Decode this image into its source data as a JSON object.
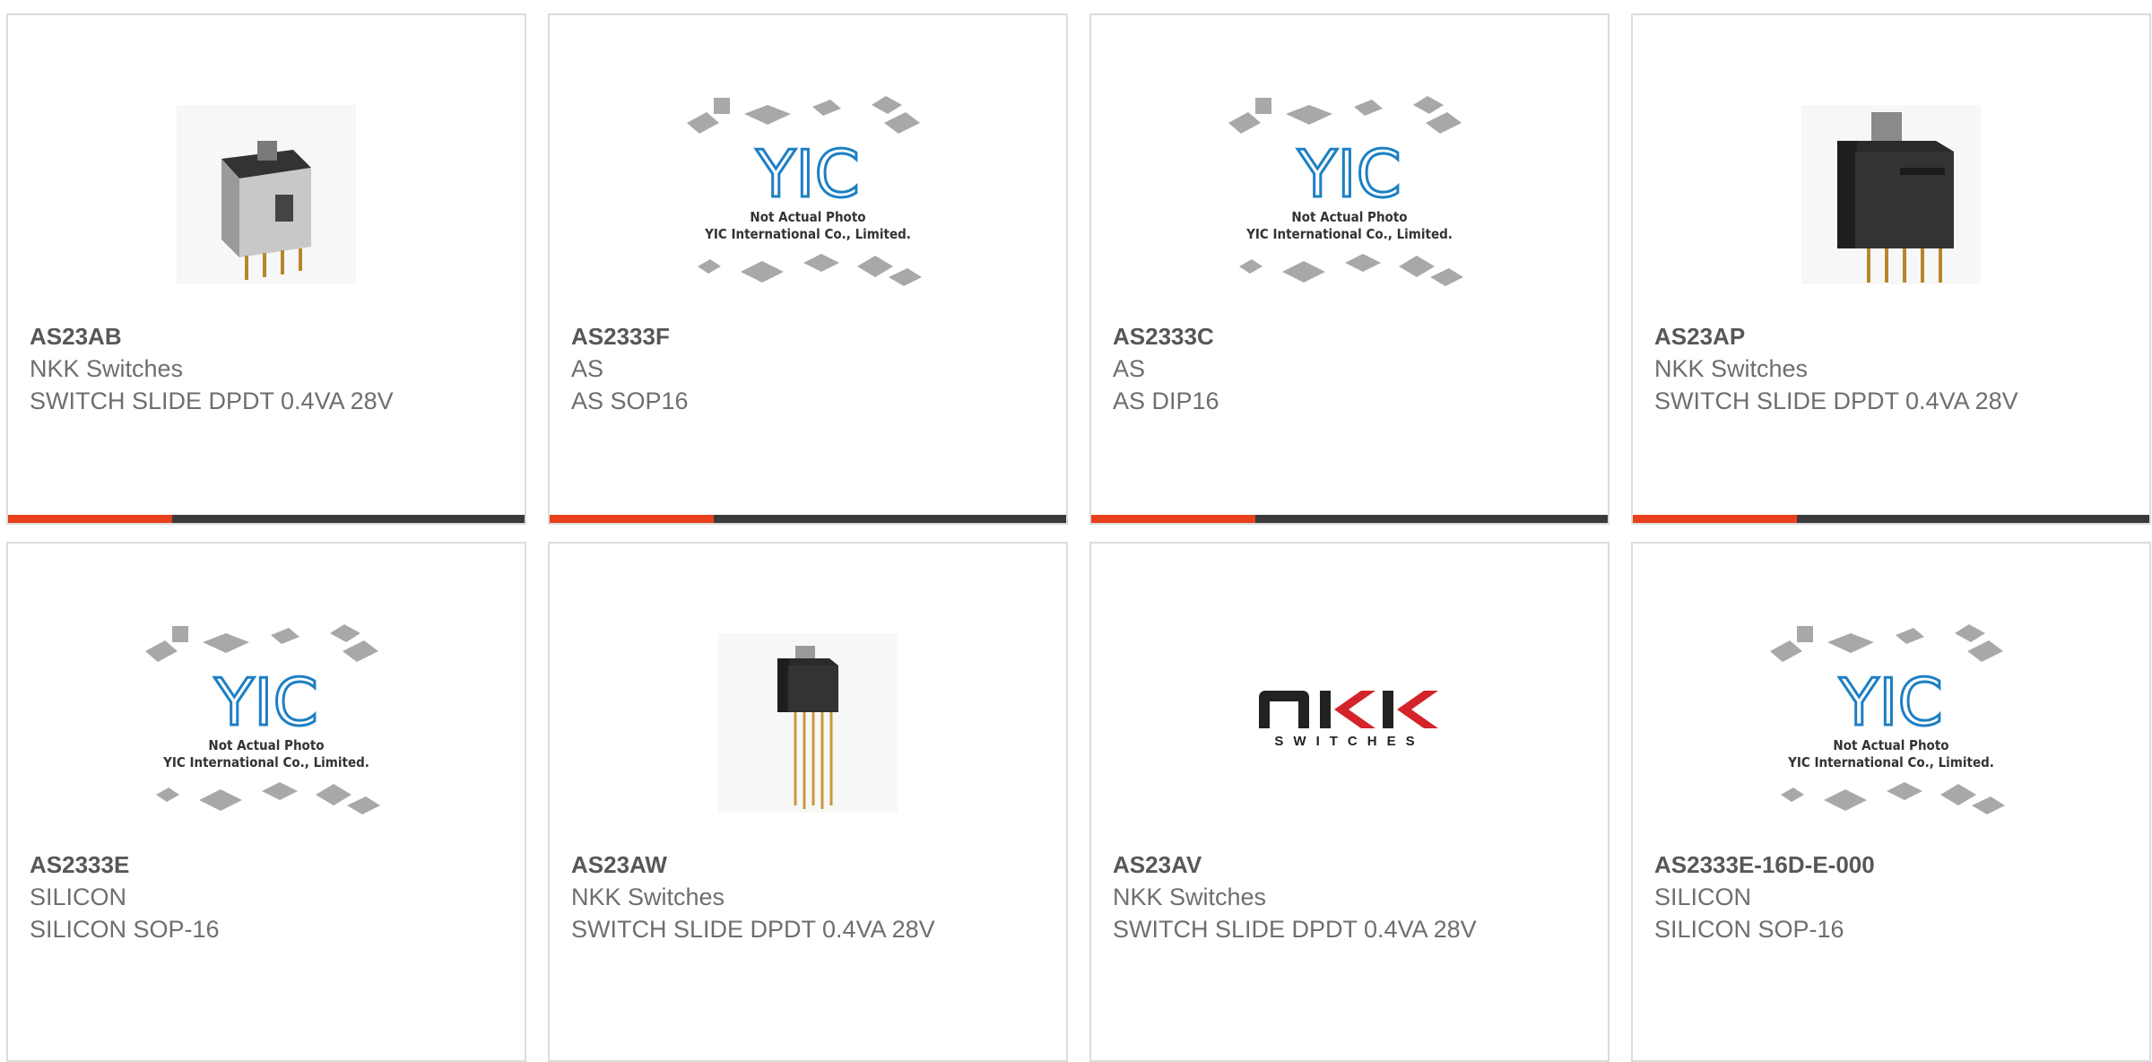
{
  "products": [
    {
      "part": "AS23AB",
      "maker": "NKK Switches",
      "desc": "SWITCH SLIDE DPDT 0.4VA 28V",
      "image": "slide-switch-photo"
    },
    {
      "part": "AS2333F",
      "maker": "AS",
      "desc": "AS SOP16",
      "image": "yic-placeholder"
    },
    {
      "part": "AS2333C",
      "maker": "AS",
      "desc": "AS DIP16",
      "image": "yic-placeholder"
    },
    {
      "part": "AS23AP",
      "maker": "NKK Switches",
      "desc": "SWITCH SLIDE DPDT 0.4VA 28V",
      "image": "slide-switch-photo"
    },
    {
      "part": "AS2333E",
      "maker": "SILICON",
      "desc": "SILICON SOP-16",
      "image": "yic-placeholder"
    },
    {
      "part": "AS23AW",
      "maker": "NKK Switches",
      "desc": "SWITCH SLIDE DPDT 0.4VA 28V",
      "image": "slide-switch-long-pins-photo"
    },
    {
      "part": "AS23AV",
      "maker": "NKK Switches",
      "desc": "SWITCH SLIDE DPDT 0.4VA 28V",
      "image": "nkk-logo"
    },
    {
      "part": "AS2333E-16D-E-000",
      "maker": "SILICON",
      "desc": "SILICON SOP-16",
      "image": "yic-placeholder"
    }
  ],
  "placeholder": {
    "logo_text": "YIC",
    "caption_line1": "Not Actual Photo",
    "caption_line2": "YIC International Co., Limited."
  },
  "nkk_logo": {
    "word": "NKK",
    "tagline": "SWITCHES"
  },
  "colors": {
    "accent": "#e8401c",
    "bar": "#3a3a3a",
    "border": "#dcdcdc",
    "logo_blue": "#1c7fc4",
    "nkk_red": "#d4232a"
  }
}
